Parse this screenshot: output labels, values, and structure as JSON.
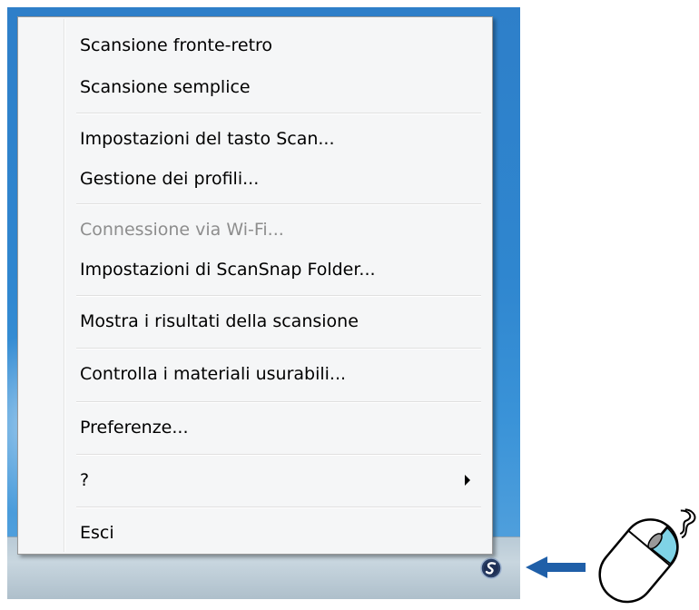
{
  "menu": {
    "items": [
      {
        "label": "Scansione fronte-retro",
        "enabled": true
      },
      {
        "label": "Scansione semplice",
        "enabled": true
      },
      {
        "label": "Impostazioni del tasto Scan...",
        "enabled": true
      },
      {
        "label": "Gestione dei profili...",
        "enabled": true
      },
      {
        "label": "Connessione via Wi-Fi...",
        "enabled": false
      },
      {
        "label": "Impostazioni di ScanSnap Folder...",
        "enabled": true
      },
      {
        "label": "Mostra i risultati della scansione",
        "enabled": true
      },
      {
        "label": "Controlla i materiali usurabili...",
        "enabled": true
      },
      {
        "label": "Preferenze...",
        "enabled": true
      },
      {
        "label": "?",
        "enabled": true,
        "has_submenu": true
      },
      {
        "label": "Esci",
        "enabled": true
      }
    ]
  },
  "tray": {
    "icon": "scansnap-manager-icon"
  },
  "annotations": {
    "pointer": "left-arrow-icon",
    "pointer_color": "#1f5fa8",
    "mouse": "mouse-icon",
    "mouse_highlight_color": "#7fd3e6"
  }
}
